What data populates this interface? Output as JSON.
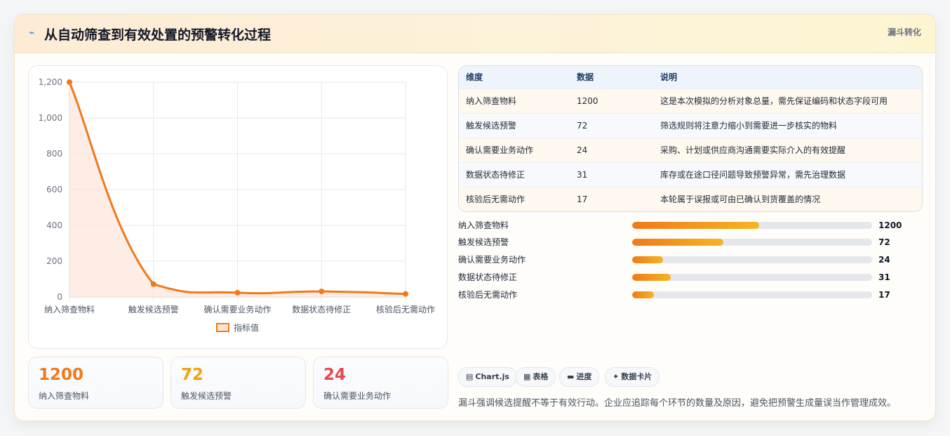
{
  "header": {
    "icon": "trend-icon",
    "title": "从自动筛查到有效处置的预警转化过程",
    "tag": "漏斗转化"
  },
  "chart_data": {
    "type": "line",
    "categories": [
      "纳入筛查物料",
      "触发候选预警",
      "确认需要业务动作",
      "数据状态待修正",
      "核验后无需动作"
    ],
    "series": [
      {
        "name": "指标值",
        "values": [
          1200,
          72,
          24,
          31,
          17
        ]
      }
    ],
    "ylim": [
      0,
      1200
    ],
    "yticks": [
      "0",
      "200",
      "400",
      "600",
      "800",
      "1,000",
      "1,200"
    ],
    "grid": true,
    "legend_position": "bottom",
    "colors": {
      "line": "#f07a1a",
      "fill": "#fde6d8"
    }
  },
  "kpis": [
    {
      "value": "1200",
      "label": "纳入筛查物料",
      "color": "#f07a1a"
    },
    {
      "value": "72",
      "label": "触发候选预警",
      "color": "#f2a20c"
    },
    {
      "value": "24",
      "label": "确认需要业务动作",
      "color": "#e5484d"
    }
  ],
  "table": {
    "headers": [
      "维度",
      "数据",
      "说明"
    ],
    "rows": [
      [
        "纳入筛查物料",
        "1200",
        "这是本次模拟的分析对象总量，需先保证编码和状态字段可用"
      ],
      [
        "触发候选预警",
        "72",
        "筛选规则将注意力缩小到需要进一步核实的物料"
      ],
      [
        "确认需要业务动作",
        "24",
        "采购、计划或供应商沟通需要实际介入的有效提醒"
      ],
      [
        "数据状态待修正",
        "31",
        "库存或在途口径问题导致预警异常，需先治理数据"
      ],
      [
        "核验后无需动作",
        "17",
        "本轮属于误报或可由已确认到货覆盖的情况"
      ]
    ]
  },
  "progress": [
    {
      "label": "纳入筛查物料",
      "value": "1200",
      "fill": 0.53
    },
    {
      "label": "触发候选预警",
      "value": "72",
      "fill": 0.38
    },
    {
      "label": "确认需要业务动作",
      "value": "24",
      "fill": 0.13
    },
    {
      "label": "数据状态待修正",
      "value": "31",
      "fill": 0.16
    },
    {
      "label": "核验后无需动作",
      "value": "17",
      "fill": 0.09
    }
  ],
  "chips": [
    {
      "icon": "chart-icon",
      "glyph": "▤",
      "label": "Chart.js"
    },
    {
      "icon": "table-icon",
      "glyph": "▦",
      "label": "表格"
    },
    {
      "icon": "progress-icon",
      "glyph": "▬",
      "label": "进度"
    },
    {
      "icon": "card-icon",
      "glyph": "✦",
      "label": "数据卡片"
    }
  ],
  "footnote": "漏斗强调候选提醒不等于有效行动。企业应追踪每个环节的数量及原因，避免把预警生成量误当作管理成效。"
}
